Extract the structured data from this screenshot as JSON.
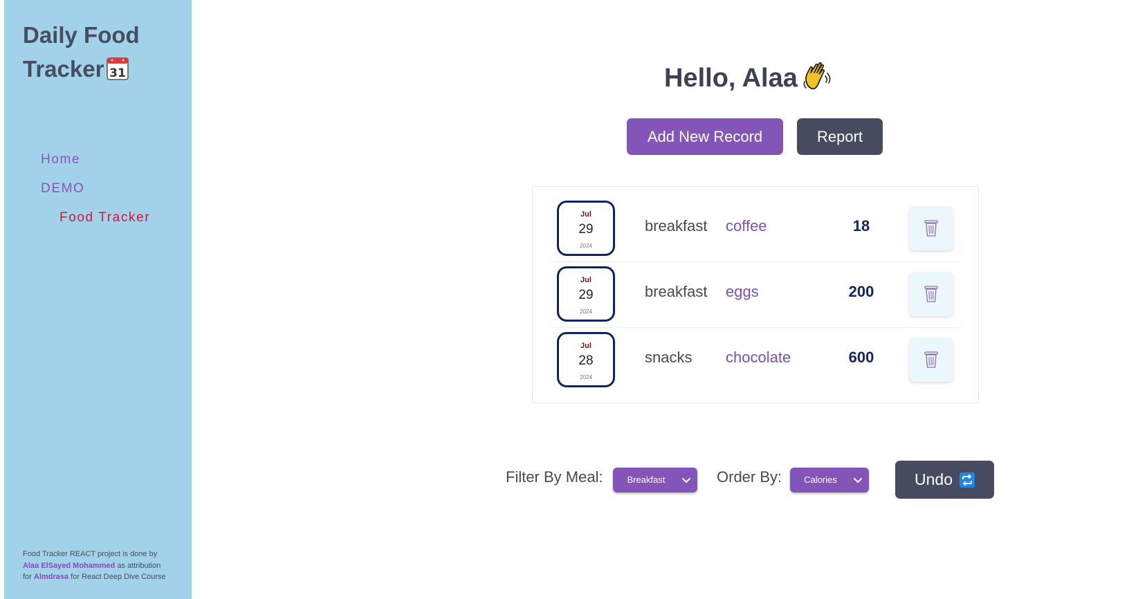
{
  "sidebar": {
    "brand_line1": "Daily Food",
    "brand_line2": "Tracker",
    "brand_icon": "calendar-emoji-icon",
    "nav": [
      {
        "label": "Home"
      },
      {
        "label": "DEMO"
      },
      {
        "label": "Food Tracker",
        "active": true
      }
    ],
    "footer": {
      "text1": "Food Tracker REACT project is done by",
      "author": "Alaa ElSayed Mohammed",
      "text2": "as attribution",
      "text3": "for",
      "org": "Almdrasa",
      "text4": "for React Deep Dive Course"
    }
  },
  "main": {
    "greeting": "Hello, Alaa",
    "greeting_icon": "waving-hand-icon",
    "add_button": "Add New Record",
    "report_button": "Report",
    "records": [
      {
        "month": "Jul",
        "day": "29",
        "year": "2024",
        "meal": "breakfast",
        "food": "coffee",
        "calories": "18"
      },
      {
        "month": "Jul",
        "day": "29",
        "year": "2024",
        "meal": "breakfast",
        "food": "eggs",
        "calories": "200"
      },
      {
        "month": "Jul",
        "day": "28",
        "year": "2024",
        "meal": "snacks",
        "food": "chocolate",
        "calories": "600"
      }
    ],
    "filter_label": "Filter By Meal:",
    "filter_value": "Breakfast",
    "order_label": "Order By:",
    "order_value": "Calories",
    "undo_button": "Undo",
    "undo_icon": "repeat-icon"
  },
  "colors": {
    "sidebar_bg": "#a2d2ea",
    "accent_purple": "#8455b8",
    "dark_button": "#484b5f",
    "active_nav": "#d2143c",
    "date_border": "#0d2464"
  }
}
